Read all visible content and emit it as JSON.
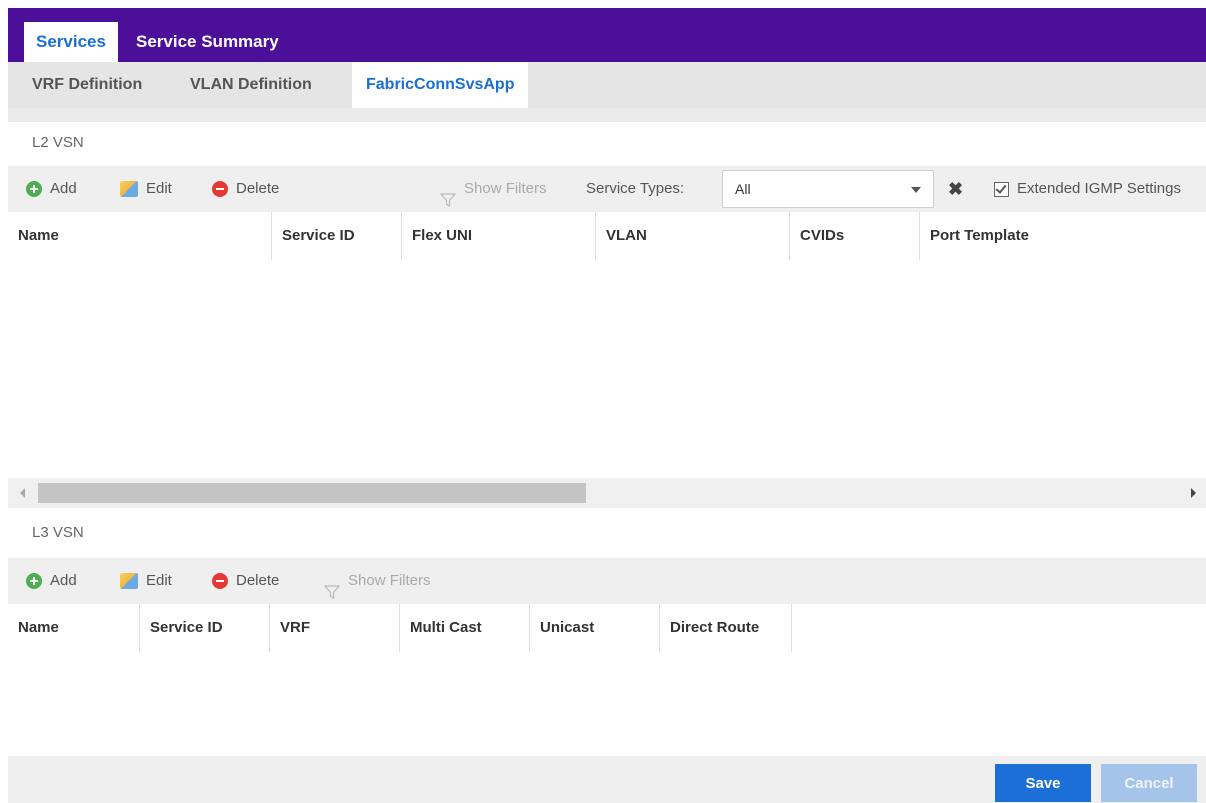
{
  "top_tabs": [
    {
      "label": "Services",
      "active": true
    },
    {
      "label": "Service Summary",
      "active": false
    }
  ],
  "sub_tabs": [
    {
      "label": "VRF Definition",
      "active": false
    },
    {
      "label": "VLAN Definition",
      "active": false
    },
    {
      "label": "FabricConnSvsApp",
      "active": true
    }
  ],
  "l2": {
    "title": "L2 VSN",
    "toolbar": {
      "add": "Add",
      "edit": "Edit",
      "delete": "Delete",
      "show_filters": "Show Filters",
      "service_types_label": "Service Types:",
      "service_types_value": "All",
      "extended_igmp": "Extended IGMP Settings",
      "extended_igmp_checked": true
    },
    "columns": [
      "Name",
      "Service ID",
      "Flex UNI",
      "VLAN",
      "CVIDs",
      "Port Template"
    ]
  },
  "l3": {
    "title": "L3 VSN",
    "toolbar": {
      "add": "Add",
      "edit": "Edit",
      "delete": "Delete",
      "show_filters": "Show Filters"
    },
    "columns": [
      "Name",
      "Service ID",
      "VRF",
      "Multi Cast",
      "Unicast",
      "Direct Route"
    ]
  },
  "footer": {
    "save": "Save",
    "cancel": "Cancel"
  },
  "colors": {
    "brand_purple": "#4b0f9a",
    "accent_blue": "#1a6fd0"
  }
}
